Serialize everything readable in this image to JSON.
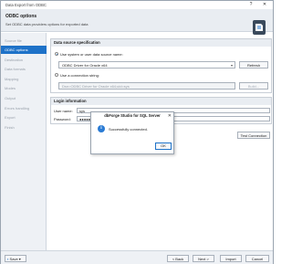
{
  "window": {
    "title": "Data Export from ODBC",
    "controls": {
      "help": "?",
      "close": "✕"
    }
  },
  "header": {
    "title": "ODBC options",
    "subtitle": "Set ODBC data providers options for exported data",
    "logo_icon": "dbforge-logo-icon"
  },
  "sidebar": {
    "items": [
      {
        "label": "Source file",
        "active": false
      },
      {
        "label": "ODBC options",
        "active": true
      },
      {
        "label": "Destination",
        "active": false
      },
      {
        "label": "Data formats",
        "active": false
      },
      {
        "label": "Mapping",
        "active": false
      },
      {
        "label": "Modes",
        "active": false
      },
      {
        "label": "Output",
        "active": false
      },
      {
        "label": "Errors handling",
        "active": false
      },
      {
        "label": "Export",
        "active": false
      },
      {
        "label": "Finish",
        "active": false
      }
    ]
  },
  "datasource": {
    "group_title": "Data source specification",
    "radio1_label": "Use system or user data source name:",
    "dsn_value": "ODBC Driver for Oracle x64",
    "refresh_label": "Refresh",
    "radio2_label": "Use a connection string:",
    "conn_value": "Dsn=ODBC Driver for Oracle x64;uid=sys",
    "build_label": "Build..."
  },
  "login": {
    "group_title": "Login information",
    "username_label": "User name:",
    "username_value": "sys",
    "password_label": "Password:",
    "password_value": "●●●●●●●"
  },
  "test_connection_label": "Test Connection",
  "dialog": {
    "title": "dbForge Studio for SQL Server",
    "message": "Successfully connected.",
    "ok_label": "OK",
    "icon": "info-icon"
  },
  "footer": {
    "save_label": "Save",
    "back_label": "< Back",
    "next_label": "Next >",
    "import_label": "Import",
    "cancel_label": "Cancel"
  },
  "colors": {
    "accent": "#1e72c8",
    "header_bg": "#e9edf2",
    "sidebar_bg": "#eef1f5"
  }
}
